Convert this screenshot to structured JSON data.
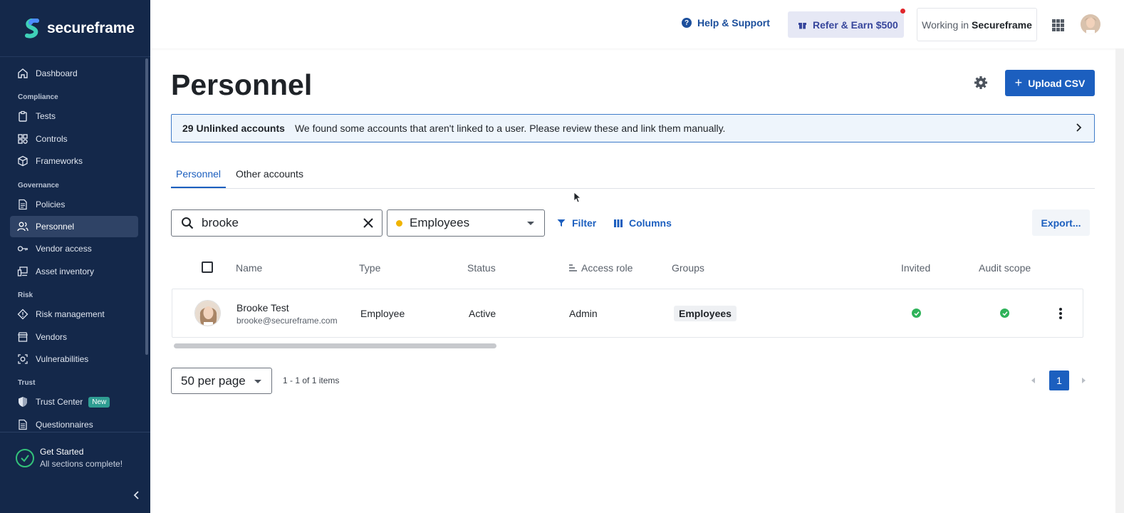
{
  "brand": {
    "name": "secureframe"
  },
  "sidebar": {
    "items": [
      {
        "label": "Dashboard",
        "icon": "home-icon"
      },
      {
        "section": "Compliance"
      },
      {
        "label": "Tests",
        "icon": "clipboard-icon"
      },
      {
        "label": "Controls",
        "icon": "controls-icon"
      },
      {
        "label": "Frameworks",
        "icon": "cube-icon"
      },
      {
        "section": "Governance"
      },
      {
        "label": "Policies",
        "icon": "document-icon"
      },
      {
        "label": "Personnel",
        "icon": "users-icon",
        "active": true
      },
      {
        "label": "Vendor access",
        "icon": "key-icon"
      },
      {
        "label": "Asset inventory",
        "icon": "devices-icon"
      },
      {
        "section": "Risk"
      },
      {
        "label": "Risk management",
        "icon": "diamond-icon"
      },
      {
        "label": "Vendors",
        "icon": "store-icon"
      },
      {
        "label": "Vulnerabilities",
        "icon": "bug-icon"
      },
      {
        "section": "Trust"
      },
      {
        "label": "Trust Center",
        "icon": "shield-icon",
        "badge": "New"
      },
      {
        "label": "Questionnaires",
        "icon": "list-icon"
      }
    ],
    "get_started": {
      "title": "Get Started",
      "subtitle": "All sections complete!"
    }
  },
  "topbar": {
    "help_label": "Help & Support",
    "refer_label": "Refer & Earn $500",
    "working_prefix": "Working in",
    "working_org": "Secureframe"
  },
  "page": {
    "title": "Personnel",
    "upload_label": "Upload CSV",
    "banner": {
      "count_label": "29 Unlinked accounts",
      "message": "We found some accounts that aren't linked to a user. Please review these and link them manually."
    },
    "tabs": [
      {
        "label": "Personnel",
        "active": true
      },
      {
        "label": "Other accounts",
        "active": false
      }
    ],
    "search": {
      "value": "brooke",
      "placeholder": ""
    },
    "type_filter": {
      "selected": "Employees"
    },
    "filter_label": "Filter",
    "columns_label": "Columns",
    "export_label": "Export...",
    "table": {
      "headers": {
        "name": "Name",
        "type": "Type",
        "status": "Status",
        "access_role": "Access role",
        "groups": "Groups",
        "invited": "Invited",
        "audit_scope": "Audit scope"
      },
      "rows": [
        {
          "name": "Brooke Test",
          "email": "brooke@secureframe.com",
          "type": "Employee",
          "status": "Active",
          "access_role": "Admin",
          "group": "Employees",
          "invited": true,
          "audit_scope": true
        }
      ]
    },
    "pagination": {
      "per_page": "50 per page",
      "range": "1 - 1 of 1 items",
      "current_page": "1"
    }
  },
  "colors": {
    "sidebar_bg": "#14284a",
    "accent": "#1c5fbf",
    "success": "#2fb35a",
    "badge_new": "#2f9e93"
  }
}
